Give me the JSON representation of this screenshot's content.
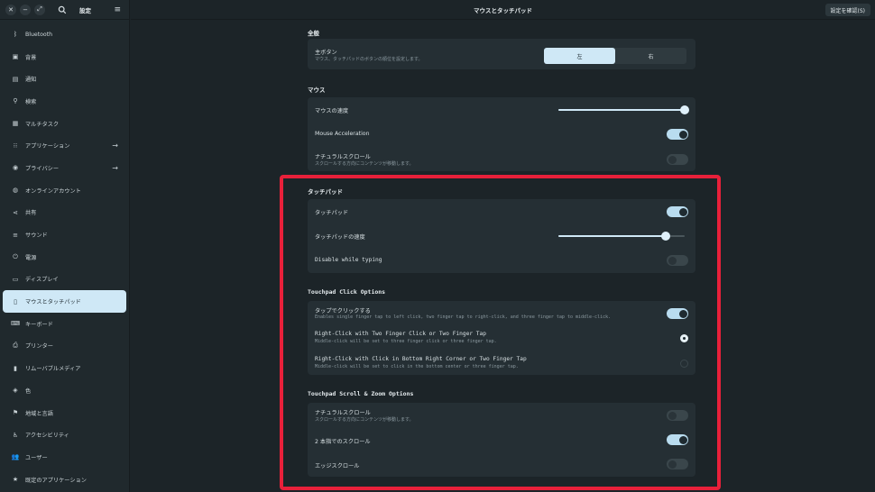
{
  "header": {
    "sidebar_title": "設定",
    "window_title": "マウスとタッチパッド",
    "confirm_button": "設定を確認(S)"
  },
  "sidebar": {
    "items": [
      {
        "label": "Bluetooth",
        "icon": "bluetooth-icon",
        "glyph": "ᛒ"
      },
      {
        "label": "背景",
        "icon": "background-icon",
        "glyph": "▣"
      },
      {
        "label": "通知",
        "icon": "notification-icon",
        "glyph": "▤"
      },
      {
        "label": "検索",
        "icon": "search-icon",
        "glyph": "⚲"
      },
      {
        "label": "マルチタスク",
        "icon": "multitask-icon",
        "glyph": "▦"
      },
      {
        "label": "アプリケーション",
        "icon": "apps-icon",
        "glyph": "⁝⁝"
      },
      {
        "label": "プライバシー",
        "icon": "privacy-icon",
        "glyph": "◉"
      },
      {
        "label": "オンラインアカウント",
        "icon": "online-accounts-icon",
        "glyph": "◍"
      },
      {
        "label": "共有",
        "icon": "share-icon",
        "glyph": "⋖"
      },
      {
        "label": "サウンド",
        "icon": "sound-icon",
        "glyph": "≡"
      },
      {
        "label": "電源",
        "icon": "power-icon",
        "glyph": "⏻"
      },
      {
        "label": "ディスプレイ",
        "icon": "display-icon",
        "glyph": "▭"
      },
      {
        "label": "マウスとタッチパッド",
        "icon": "mouse-icon",
        "glyph": "▯"
      },
      {
        "label": "キーボード",
        "icon": "keyboard-icon",
        "glyph": "⌨"
      },
      {
        "label": "プリンター",
        "icon": "printer-icon",
        "glyph": "⎙"
      },
      {
        "label": "リムーバブルメディア",
        "icon": "removable-media-icon",
        "glyph": "▮"
      },
      {
        "label": "色",
        "icon": "color-icon",
        "glyph": "◈"
      },
      {
        "label": "地域と言語",
        "icon": "region-icon",
        "glyph": "⚑"
      },
      {
        "label": "アクセシビリティ",
        "icon": "accessibility-icon",
        "glyph": "♿"
      },
      {
        "label": "ユーザー",
        "icon": "users-icon",
        "glyph": "👥"
      },
      {
        "label": "既定のアプリケーション",
        "icon": "default-apps-icon",
        "glyph": "★"
      }
    ],
    "active_index": 12,
    "arrow_indices": [
      5,
      6
    ]
  },
  "general": {
    "title": "全般",
    "primary_button_label": "主ボタン",
    "primary_button_sub": "マウス、タッチパッドのボタンの順位を設定します。",
    "left": "左",
    "right": "右",
    "selected": "左"
  },
  "mouse": {
    "title": "マウス",
    "speed_label": "マウスの速度",
    "speed_value": 1.0,
    "acceleration_label": "Mouse Acceleration",
    "acceleration_on": true,
    "natural_scroll_label": "ナチュラルスクロール",
    "natural_scroll_sub": "スクロールする方向にコンテンツが移動します。",
    "natural_scroll_on": false
  },
  "touchpad": {
    "title": "タッチパッド",
    "touchpad_label": "タッチパッド",
    "touchpad_on": true,
    "speed_label": "タッチパッドの速度",
    "speed_value": 0.85,
    "disable_typing_label": "Disable while typing",
    "disable_typing_on": false
  },
  "click_options": {
    "title": "Touchpad Click Options",
    "tap_label": "タップでクリックする",
    "tap_sub": "Enables single finger tap to left click, two finger tap to right-click, and three finger tap to middle-click.",
    "tap_on": true,
    "two_finger_label": "Right-Click with Two Finger Click or Two Finger Tap",
    "two_finger_sub": "Middle-click will be set to three finger click or three finger tap.",
    "two_finger_checked": true,
    "corner_label": "Right-Click with Click in Bottom Right Corner or Two Finger Tap",
    "corner_sub": "Middle-click will be set to click in the bottom center or three finger tap.",
    "corner_checked": false
  },
  "scroll_options": {
    "title": "Touchpad Scroll & Zoom Options",
    "natural_label": "ナチュラルスクロール",
    "natural_sub": "スクロールする方向にコンテンツが移動します。",
    "natural_on": false,
    "two_finger_label": "2 本指でのスクロール",
    "two_finger_on": true,
    "edge_label": "エッジスクロール",
    "edge_on": false
  },
  "colors": {
    "accent": "#cfe8f6",
    "highlight_border": "#e8203a",
    "background": "#1c2428",
    "card": "#252f34"
  }
}
